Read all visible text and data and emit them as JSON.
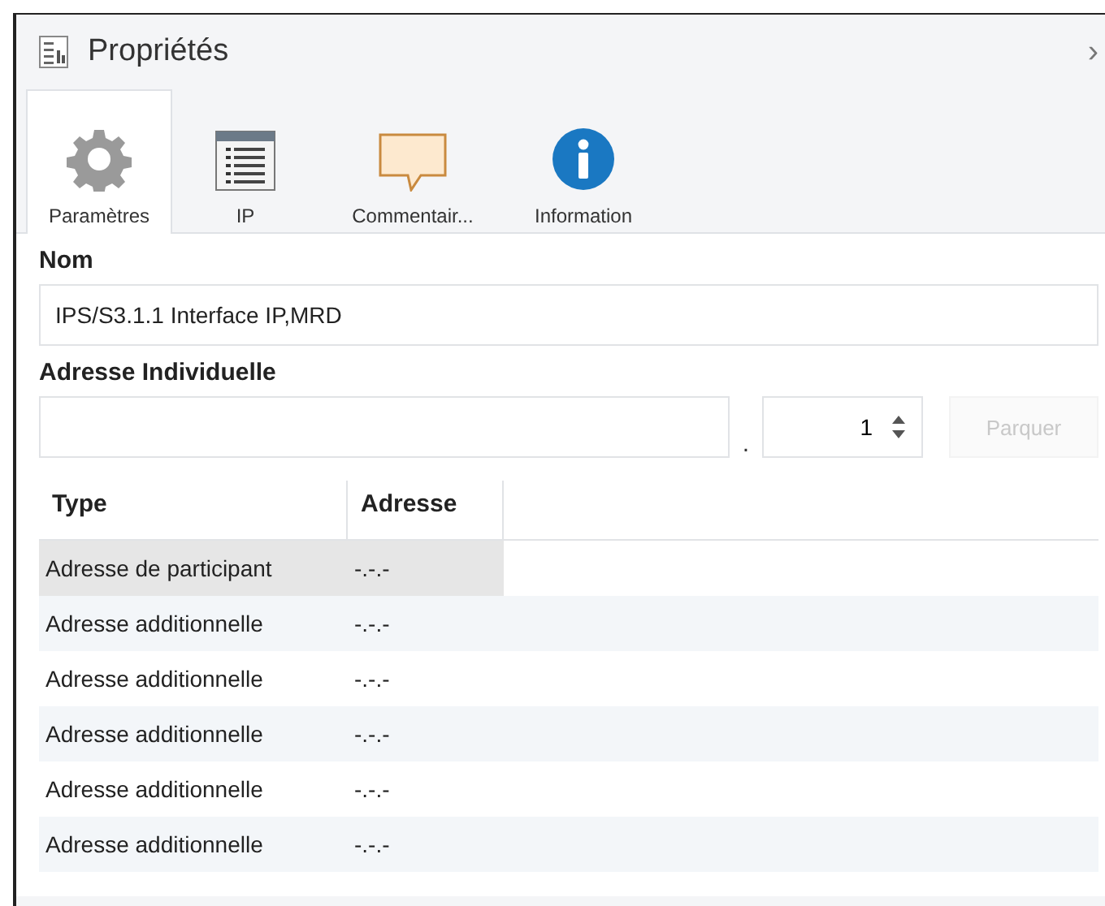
{
  "panel": {
    "title": "Propriétés",
    "close": "›"
  },
  "tabs": [
    {
      "label": "Paramètres",
      "selected": true
    },
    {
      "label": "IP",
      "selected": false
    },
    {
      "label": "Commentair...",
      "selected": false
    },
    {
      "label": "Information",
      "selected": false
    }
  ],
  "name": {
    "label": "Nom",
    "value": "IPS/S3.1.1 Interface IP,MRD"
  },
  "address": {
    "label": "Adresse Individuelle",
    "separator": ".",
    "number": "1",
    "park_button": {
      "label": "Parquer",
      "disabled": true
    }
  },
  "table": {
    "columns": [
      "Type",
      "Adresse"
    ],
    "rows": [
      {
        "type": "Adresse de participant",
        "address": "-.-.-",
        "selected": true
      },
      {
        "type": "Adresse additionnelle",
        "address": "-.-.-",
        "selected": false
      },
      {
        "type": "Adresse additionnelle",
        "address": "-.-.-",
        "selected": false
      },
      {
        "type": "Adresse additionnelle",
        "address": "-.-.-",
        "selected": false
      },
      {
        "type": "Adresse additionnelle",
        "address": "-.-.-",
        "selected": false
      },
      {
        "type": "Adresse additionnelle",
        "address": "-.-.-",
        "selected": false
      }
    ]
  }
}
